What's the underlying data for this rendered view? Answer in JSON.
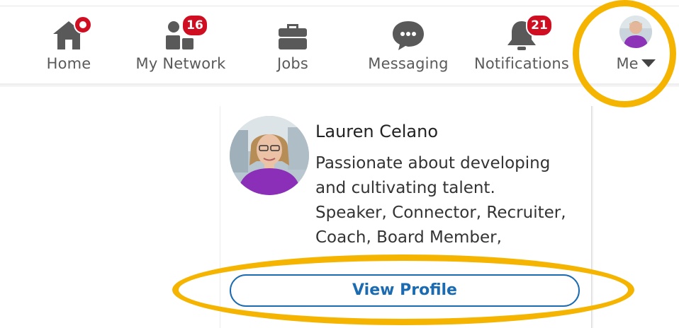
{
  "nav": {
    "items": [
      {
        "label": "Home",
        "badge": ""
      },
      {
        "label": "My Network",
        "badge": "16"
      },
      {
        "label": "Jobs",
        "badge": ""
      },
      {
        "label": "Messaging",
        "badge": ""
      },
      {
        "label": "Notifications",
        "badge": "21"
      },
      {
        "label": "Me",
        "badge": ""
      }
    ]
  },
  "profile": {
    "name": "Lauren Celano",
    "headline_lines": [
      "Passionate about developing",
      "and cultivating talent.",
      "Speaker, Connector, Recruiter,",
      "Coach, Board Member,"
    ],
    "view_profile_label": "View Profile"
  },
  "colors": {
    "badge": "#cf0e22",
    "link_blue": "#1b6bb2",
    "highlight": "#f4b400",
    "icon_gray": "#595959"
  },
  "icons": {
    "home": "home-icon",
    "network": "people-icon",
    "jobs": "briefcase-icon",
    "messaging": "chat-bubble-icon",
    "notifications": "bell-icon",
    "me": "avatar"
  }
}
